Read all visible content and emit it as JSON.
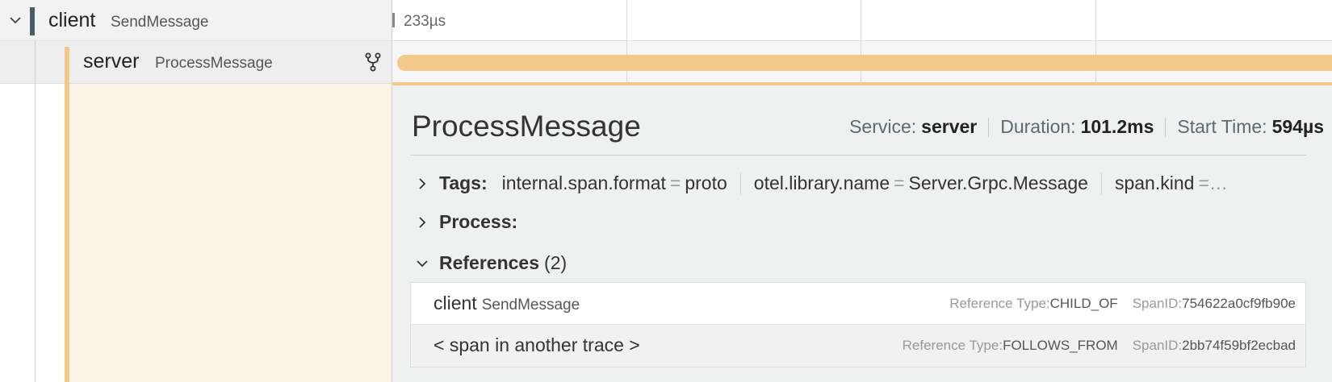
{
  "tree": {
    "client": {
      "service": "client",
      "operation": "SendMessage",
      "expanded": true,
      "icon": "chevron-down-icon",
      "color": "#4d5d66"
    },
    "server": {
      "service": "server",
      "operation": "ProcessMessage",
      "icon": "fork-icon",
      "color": "#f3c98b"
    }
  },
  "timeline": {
    "tick_label": "233µs",
    "span_bar_color": "#f3c98b"
  },
  "detail": {
    "title": "ProcessMessage",
    "service_label": "Service:",
    "service_value": "server",
    "duration_label": "Duration:",
    "duration_value": "101.2ms",
    "start_label": "Start Time:",
    "start_value": "594µs",
    "tags": {
      "label": "Tags:",
      "expanded": false,
      "items": [
        {
          "key": "internal.span.format",
          "eq": "=",
          "value": "proto"
        },
        {
          "key": "otel.library.name",
          "eq": "=",
          "value": "Server.Grpc.Message"
        },
        {
          "key": "span.kind",
          "eq": "=…",
          "value": ""
        }
      ]
    },
    "process": {
      "label": "Process:",
      "expanded": false
    },
    "references": {
      "label": "References",
      "count": "(2)",
      "expanded": true,
      "rows": [
        {
          "main": "client",
          "op": "SendMessage",
          "type_label": "Reference Type:",
          "type_value": "CHILD_OF",
          "span_label": "SpanID:",
          "span_value": "754622a0cf9fb90e"
        },
        {
          "main": "< span in another trace >",
          "op": "",
          "type_label": "Reference Type:",
          "type_value": "FOLLOWS_FROM",
          "span_label": "SpanID:",
          "span_value": "2bb74f59bf2ecbad"
        }
      ]
    }
  }
}
